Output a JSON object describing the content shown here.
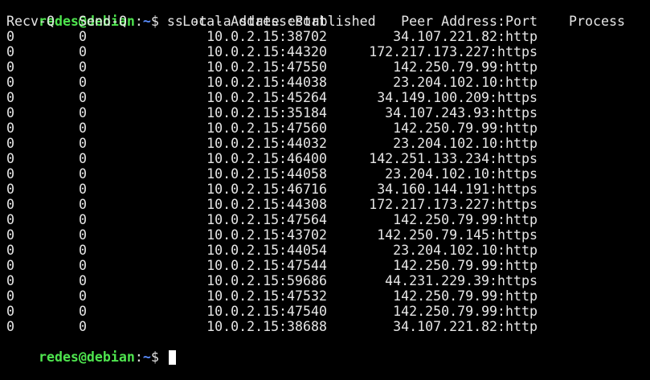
{
  "terminal": {
    "command_prompt": {
      "user_host": "redes@debian",
      "colon": ":",
      "path": "~",
      "dollar": "$",
      "command": " ss -t -a state established"
    },
    "headers": {
      "recv_q": "Recv-Q",
      "send_q": "Send-Q",
      "local": "Local Address:Port",
      "peer": "Peer Address:Port",
      "process": "Process"
    },
    "rows": [
      {
        "recv": "0",
        "send": "0",
        "local": "10.0.2.15:38702",
        "peer": "34.107.221.82:http"
      },
      {
        "recv": "0",
        "send": "0",
        "local": "10.0.2.15:44320",
        "peer": "172.217.173.227:https"
      },
      {
        "recv": "0",
        "send": "0",
        "local": "10.0.2.15:47550",
        "peer": "142.250.79.99:http"
      },
      {
        "recv": "0",
        "send": "0",
        "local": "10.0.2.15:44038",
        "peer": "23.204.102.10:http"
      },
      {
        "recv": "0",
        "send": "0",
        "local": "10.0.2.15:45264",
        "peer": "34.149.100.209:https"
      },
      {
        "recv": "0",
        "send": "0",
        "local": "10.0.2.15:35184",
        "peer": "34.107.243.93:https"
      },
      {
        "recv": "0",
        "send": "0",
        "local": "10.0.2.15:47560",
        "peer": "142.250.79.99:http"
      },
      {
        "recv": "0",
        "send": "0",
        "local": "10.0.2.15:44032",
        "peer": "23.204.102.10:http"
      },
      {
        "recv": "0",
        "send": "0",
        "local": "10.0.2.15:46400",
        "peer": "142.251.133.234:https"
      },
      {
        "recv": "0",
        "send": "0",
        "local": "10.0.2.15:44058",
        "peer": "23.204.102.10:https"
      },
      {
        "recv": "0",
        "send": "0",
        "local": "10.0.2.15:46716",
        "peer": "34.160.144.191:https"
      },
      {
        "recv": "0",
        "send": "0",
        "local": "10.0.2.15:44308",
        "peer": "172.217.173.227:https"
      },
      {
        "recv": "0",
        "send": "0",
        "local": "10.0.2.15:47564",
        "peer": "142.250.79.99:http"
      },
      {
        "recv": "0",
        "send": "0",
        "local": "10.0.2.15:43702",
        "peer": "142.250.79.145:https"
      },
      {
        "recv": "0",
        "send": "0",
        "local": "10.0.2.15:44054",
        "peer": "23.204.102.10:http"
      },
      {
        "recv": "0",
        "send": "0",
        "local": "10.0.2.15:47544",
        "peer": "142.250.79.99:http"
      },
      {
        "recv": "0",
        "send": "0",
        "local": "10.0.2.15:59686",
        "peer": "44.231.229.39:https"
      },
      {
        "recv": "0",
        "send": "0",
        "local": "10.0.2.15:47532",
        "peer": "142.250.79.99:http"
      },
      {
        "recv": "0",
        "send": "0",
        "local": "10.0.2.15:47540",
        "peer": "142.250.79.99:http"
      },
      {
        "recv": "0",
        "send": "0",
        "local": "10.0.2.15:38688",
        "peer": "34.107.221.82:http"
      }
    ],
    "final_prompt": {
      "user_host": "redes@debian",
      "colon": ":",
      "path": "~",
      "dollar": "$ "
    }
  },
  "colors": {
    "background": "#000000",
    "text": "#e6e6e6",
    "prompt_user": "#4ee44e",
    "prompt_path": "#5a8dff",
    "cursor": "#ffffff"
  }
}
